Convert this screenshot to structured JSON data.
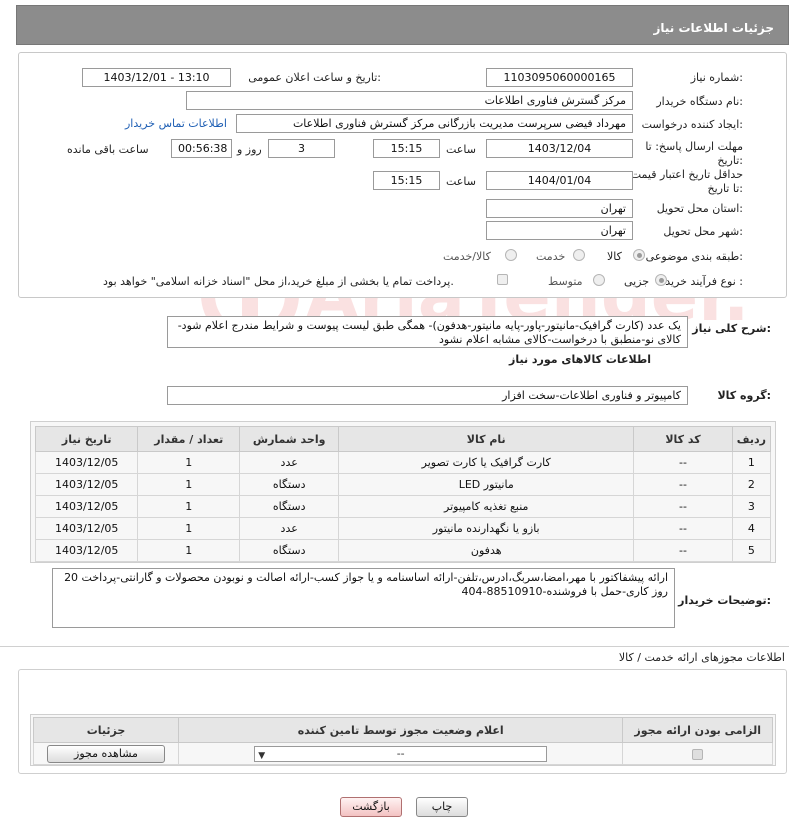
{
  "header": {
    "title": "جزئیات اطلاعات نیاز"
  },
  "form": {
    "need_number_label": "شماره نیاز:",
    "need_number": "1103095060000165",
    "announce_label": "تاریخ و ساعت اعلان عمومی:",
    "announce_value": "1403/12/01 - 13:10",
    "buyer_org_label": "نام دستگاه خریدار:",
    "buyer_org": "مرکز گسترش فناوری اطلاعات",
    "requester_label": "ایجاد کننده درخواست:",
    "requester": "مهرداد فیضی سرپرست مدیریت بازرگانی مرکز گسترش فناوری اطلاعات",
    "contact_link": "اطلاعات تماس خریدار",
    "deadline_label": "مهلت ارسال پاسخ: تا تاریخ:",
    "deadline_date": "1403/12/04",
    "time_label": "ساعت",
    "deadline_time": "15:15",
    "days": "3",
    "days_label": "روز و",
    "remaining": "00:56:38",
    "remaining_label": "ساعت باقی مانده",
    "validity_label": "حداقل تاریخ اعتبار قیمت: تا تاریخ:",
    "validity_date": "1404/01/04",
    "validity_time": "15:15",
    "province_label": "استان محل تحویل:",
    "province": "تهران",
    "city_label": "شهر محل تحویل:",
    "city": "تهران",
    "category_label": "طبقه بندی موضوعی:",
    "category_options": [
      "کالا",
      "خدمت",
      "کالا/خدمت"
    ],
    "process_label": "نوع فرآیند خرید :",
    "process_options": [
      "جزیی",
      "متوسط"
    ],
    "payment_note": "پرداخت تمام یا بخشی از مبلغ خرید،از محل \"اسناد خزانه اسلامی\" خواهد بود."
  },
  "description": {
    "label": "شرح کلی نیاز:",
    "text": "یک عدد (کارت گرافیک-مانیتور-پاور-پایه مانیتور-هدفون)- همگی طبق لیست پیوست و شرایط مندرج اعلام شود-کالای نو-منطبق با درخواست-کالای مشابه اعلام نشود"
  },
  "goods": {
    "section_title": "اطلاعات کالاهای مورد نیاز",
    "group_label": "گروه کالا:",
    "group_value": "کامپیوتر و فناوری اطلاعات-سخت افزار",
    "columns": [
      "ردیف",
      "کد کالا",
      "نام کالا",
      "واحد شمارش",
      "تعداد / مقدار",
      "تاریخ نیاز"
    ],
    "rows": [
      {
        "row": "1",
        "code": "--",
        "name": "کارت گرافیک یا کارت تصویر",
        "unit": "عدد",
        "qty": "1",
        "date": "1403/12/05"
      },
      {
        "row": "2",
        "code": "--",
        "name": "مانیتور LED",
        "unit": "دستگاه",
        "qty": "1",
        "date": "1403/12/05"
      },
      {
        "row": "3",
        "code": "--",
        "name": "منبع تغذیه کامپیوتر",
        "unit": "دستگاه",
        "qty": "1",
        "date": "1403/12/05"
      },
      {
        "row": "4",
        "code": "--",
        "name": "بازو یا نگهدارنده مانیتور",
        "unit": "عدد",
        "qty": "1",
        "date": "1403/12/05"
      },
      {
        "row": "5",
        "code": "--",
        "name": "هدفون",
        "unit": "دستگاه",
        "qty": "1",
        "date": "1403/12/05"
      }
    ]
  },
  "buyer_notes": {
    "label": "توضیحات خریدار:",
    "text": "ارائه پیشفاکتور با مهر،امضا،سربگ،ادرس،تلفن-ارائه اساسنامه و یا جواز کسب-ارائه اصالت و نوبودن محصولات و گارانتی-پرداخت 20 روز کاری-حمل با فروشنده-88510910-404"
  },
  "permits": {
    "title": "اطلاعات مجوزهای ارائه خدمت / کالا",
    "columns": [
      "الزامی بودن ارائه مجوز",
      "اعلام وضعیت مجوز توسط تامین کننده",
      "جزئیات"
    ],
    "select_value": "--",
    "view_button": "مشاهده مجوز"
  },
  "footer": {
    "print": "چاپ",
    "back": "بازگشت"
  },
  "watermark": "AriaTender.neT",
  "colors": {
    "header_bg": "#8c8c8c",
    "link": "#1f5fb4",
    "back_button": "#f3c2c2"
  }
}
